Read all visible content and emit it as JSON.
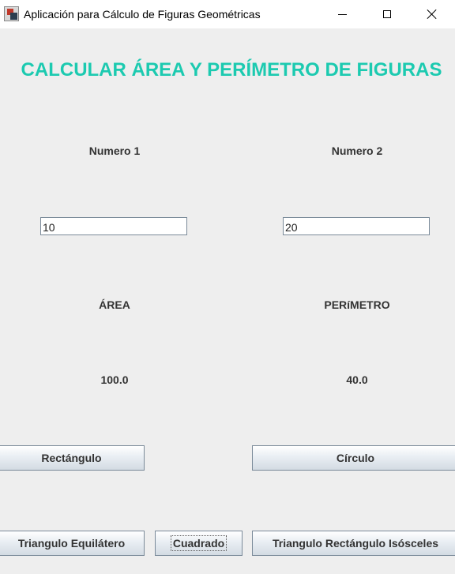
{
  "window": {
    "title": "Aplicación para Cálculo de Figuras Geométricas",
    "icon": "app-geometry-icon"
  },
  "window_controls": {
    "minimize_icon": "minimize-icon",
    "maximize_icon": "maximize-icon",
    "close_icon": "close-icon"
  },
  "heading": "CALCULAR ÁREA Y PERÍMETRO DE FIGURAS",
  "colors": {
    "heading": "#1ccab0",
    "background": "#eeeeee"
  },
  "inputs": {
    "numero1": {
      "label": "Numero 1",
      "value": "10"
    },
    "numero2": {
      "label": "Numero 2",
      "value": "20"
    }
  },
  "results": {
    "area": {
      "label": "ÁREA",
      "value": "100.0"
    },
    "perimetro": {
      "label": "PERíMETRO",
      "value": "40.0"
    }
  },
  "buttons": {
    "rectangulo": "Rectángulo",
    "circulo": "Círculo",
    "triangulo_equilatero": "Triangulo Equilátero",
    "cuadrado": "Cuadrado",
    "triangulo_rectangulo_isosceles": "Triangulo Rectángulo Isósceles"
  }
}
